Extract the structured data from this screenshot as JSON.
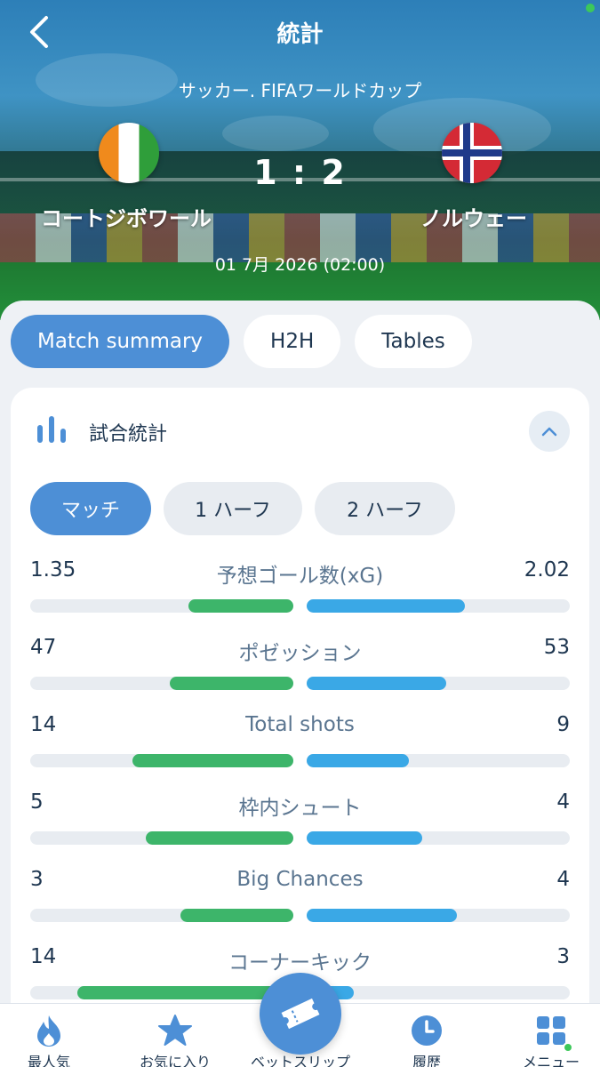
{
  "header": {
    "title": "統計",
    "competition": "サッカー. FIFAワールドカップ",
    "home_team": "コートジボワール",
    "away_team": "ノルウェー",
    "score": "1 : 2",
    "date": "01 7月 2026 (02:00)"
  },
  "tabs": [
    {
      "label": "Match summary",
      "active": true
    },
    {
      "label": "H2H",
      "active": false
    },
    {
      "label": "Tables",
      "active": false
    }
  ],
  "stats_card": {
    "title": "試合統計",
    "periods": [
      {
        "label": "マッチ",
        "active": true
      },
      {
        "label": "1 ハーフ",
        "active": false
      },
      {
        "label": "2 ハーフ",
        "active": false
      }
    ],
    "rows": [
      {
        "label": "予想ゴール数(xG)",
        "home": "1.35",
        "away": "2.02",
        "home_share": 0.4,
        "away_share": 0.6
      },
      {
        "label": "ポゼッション",
        "home": "47",
        "away": "53",
        "home_share": 0.47,
        "away_share": 0.53
      },
      {
        "label": "Total shots",
        "home": "14",
        "away": "9",
        "home_share": 0.61,
        "away_share": 0.39
      },
      {
        "label": "枠内シュート",
        "home": "5",
        "away": "4",
        "home_share": 0.56,
        "away_share": 0.44
      },
      {
        "label": "Big Chances",
        "home": "3",
        "away": "4",
        "home_share": 0.43,
        "away_share": 0.57
      },
      {
        "label": "コーナーキック",
        "home": "14",
        "away": "3",
        "home_share": 0.82,
        "away_share": 0.18
      }
    ]
  },
  "bottom_nav": [
    {
      "label": "最人気",
      "icon": "flame-icon"
    },
    {
      "label": "お気に入り",
      "icon": "star-icon"
    },
    {
      "label": "ベットスリップ",
      "icon": "ticket-icon"
    },
    {
      "label": "履歴",
      "icon": "clock-icon"
    },
    {
      "label": "メニュー",
      "icon": "grid-menu-icon"
    }
  ],
  "colors": {
    "accent": "#4d8fd6",
    "home_bar": "#3db56a",
    "away_bar": "#3aa8e6",
    "text_dark": "#1e3650"
  }
}
